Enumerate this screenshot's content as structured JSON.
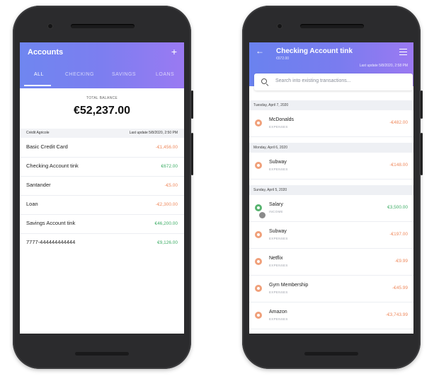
{
  "left": {
    "header": {
      "title": "Accounts",
      "add_symbol": "+"
    },
    "tabs": [
      {
        "label": "ALL",
        "active": true
      },
      {
        "label": "CHECKING",
        "active": false
      },
      {
        "label": "SAVINGS",
        "active": false
      },
      {
        "label": "LOANS",
        "active": false
      }
    ],
    "total_label": "TOTAL BALANCE",
    "total_value": "€52,237.00",
    "bank": "Crédit Agricole",
    "last_update": "Last update 5/8/2020, 2:50 PM",
    "accounts": [
      {
        "name": "Basic Credit Card",
        "value": "-€1,456.00",
        "color": "#ef8a5e"
      },
      {
        "name": "Checking Account tink",
        "value": "€672.00",
        "color": "#3fae67"
      },
      {
        "name": "Santander",
        "value": "-€5.00",
        "color": "#ef8a5e"
      },
      {
        "name": "Loan",
        "value": "-€2,300.00",
        "color": "#ef8a5e"
      },
      {
        "name": "Savings Account tink",
        "value": "€46,200.00",
        "color": "#3fae67"
      },
      {
        "name": "7777-444444444444",
        "value": "€9,126.00",
        "color": "#3fae67"
      }
    ]
  },
  "right": {
    "header": {
      "back_symbol": "←",
      "title": "Checking Account tink",
      "subtitle": "€672.00",
      "last_update": "Last update 5/8/2020, 2:58 PM"
    },
    "search_placeholder": "Search into existing transactions...",
    "groups": [
      {
        "date": "Tuesday, April 7, 2020",
        "items": [
          {
            "name": "McDonalds",
            "category": "EXPENSES",
            "amount": "-€482.00",
            "type": "expense"
          }
        ]
      },
      {
        "date": "Monday, April 6, 2020",
        "items": [
          {
            "name": "Subway",
            "category": "EXPENSES",
            "amount": "-€148.00",
            "type": "expense"
          }
        ]
      },
      {
        "date": "Sunday, April 5, 2020",
        "items": [
          {
            "name": "Salary",
            "category": "INCOME",
            "amount": "€3,500.00",
            "type": "income"
          },
          {
            "name": "Subway",
            "category": "EXPENSES",
            "amount": "-€197.00",
            "type": "expense"
          },
          {
            "name": "Netflix",
            "category": "EXPENSES",
            "amount": "-€9.99",
            "type": "expense"
          },
          {
            "name": "Gym Membership",
            "category": "EXPENSES",
            "amount": "-€45.99",
            "type": "expense"
          },
          {
            "name": "Amazon",
            "category": "EXPENSES",
            "amount": "-€3,743.99",
            "type": "expense"
          }
        ]
      }
    ],
    "colors": {
      "expense": "#ef8a5e",
      "income": "#3fae67"
    }
  }
}
